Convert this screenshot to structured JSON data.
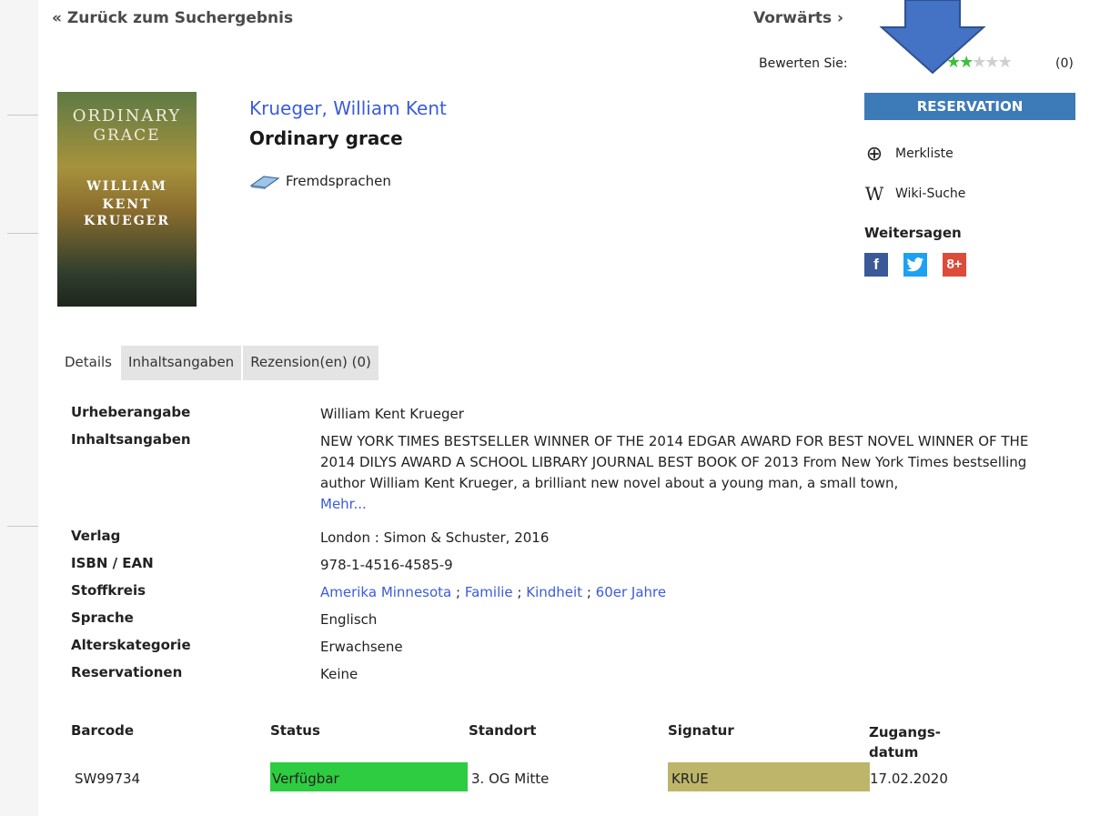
{
  "nav": {
    "back_label": "« Zurück zum Suchergebnis",
    "forward_label": "Vorwärts ›"
  },
  "rating": {
    "label": "Bewerten Sie:",
    "stars_filled": 2,
    "stars_total": 5,
    "count": "(0)"
  },
  "book": {
    "author": "Krueger, William Kent",
    "title": "Ordinary grace",
    "genre": "Fremdsprachen",
    "cover": {
      "title_line1": "ORDINARY",
      "title_line2": "GRACE",
      "author_line1": "WILLIAM",
      "author_line2": "KENT",
      "author_line3": "KRUEGER"
    }
  },
  "actions": {
    "reserve_label": "RESERVATION",
    "merkliste_label": "Merkliste",
    "wiki_label": "Wiki-Suche",
    "share_heading": "Weitersagen"
  },
  "social": {
    "facebook": "f",
    "google": "8+"
  },
  "colors": {
    "accent": "#3d7ab8",
    "link": "#3a5cdb",
    "available": "#2ecc40",
    "signatur": "#bdb56a"
  },
  "tabs": [
    {
      "label": "Details"
    },
    {
      "label": "Inhaltsangaben"
    },
    {
      "label": "Rezension(en) (0)"
    }
  ],
  "details": {
    "urheber_label": "Urheberangabe",
    "urheber_value": "William Kent Krueger",
    "inhalt_label": "Inhaltsangaben",
    "inhalt_value": "NEW YORK TIMES BESTSELLER WINNER OF THE 2014 EDGAR AWARD FOR BEST NOVEL WINNER OF THE 2014 DILYS AWARD A SCHOOL LIBRARY JOURNAL BEST BOOK OF 2013 From New York Times bestselling author William Kent Krueger, a brilliant new novel about a young man, a small town,",
    "mehr_label": "Mehr...",
    "verlag_label": "Verlag",
    "verlag_value": "London : Simon & Schuster, 2016",
    "isbn_label": "ISBN / EAN",
    "isbn_value": "978-1-4516-4585-9",
    "stoffkreis_label": "Stoffkreis",
    "stoffkreis_values": [
      "Amerika Minnesota",
      "Familie",
      "Kindheit",
      "60er Jahre"
    ],
    "sprache_label": "Sprache",
    "sprache_value": "Englisch",
    "alter_label": "Alterskategorie",
    "alter_value": "Erwachsene",
    "reserv_label": "Reservationen",
    "reserv_value": "Keine"
  },
  "holdings": {
    "headers": {
      "barcode": "Barcode",
      "status": "Status",
      "standort": "Standort",
      "signatur": "Signatur",
      "zugang_line1": "Zugangs-",
      "zugang_line2": "datum"
    },
    "row": {
      "barcode": "SW99734",
      "status": "Verfügbar",
      "standort": "3. OG Mitte",
      "signatur": "KRUE",
      "zugang": "17.02.2020"
    }
  }
}
